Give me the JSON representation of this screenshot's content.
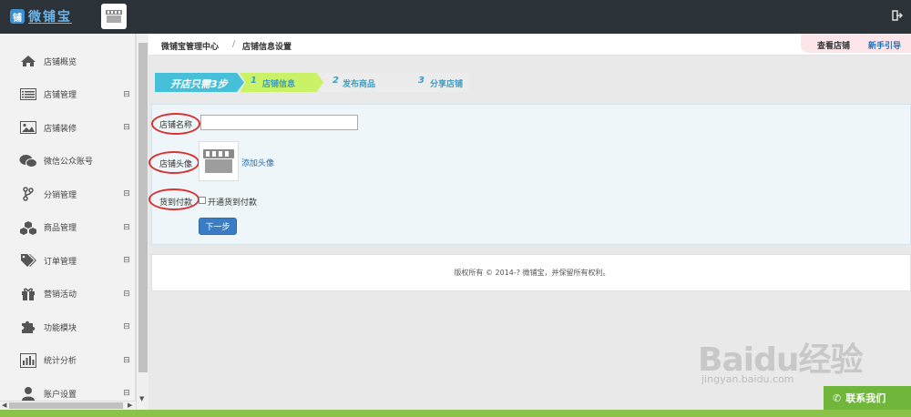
{
  "app": {
    "logo_badge": "铺",
    "logo_text": "微铺宝"
  },
  "sidebar": {
    "items": [
      {
        "label": "店铺概览",
        "icon": "home-icon",
        "expandable": false
      },
      {
        "label": "店铺管理",
        "icon": "list-icon",
        "expandable": true
      },
      {
        "label": "店铺装修",
        "icon": "image-icon",
        "expandable": true
      },
      {
        "label": "微信公众账号",
        "icon": "wechat-icon",
        "expandable": false
      },
      {
        "label": "分销管理",
        "icon": "branch-icon",
        "expandable": true
      },
      {
        "label": "商品管理",
        "icon": "cubes-icon",
        "expandable": true
      },
      {
        "label": "订单管理",
        "icon": "tags-icon",
        "expandable": true
      },
      {
        "label": "营销活动",
        "icon": "gift-icon",
        "expandable": true
      },
      {
        "label": "功能模块",
        "icon": "puzzle-icon",
        "expandable": true
      },
      {
        "label": "统计分析",
        "icon": "bar-chart-icon",
        "expandable": true
      },
      {
        "label": "账户设置",
        "icon": "user-icon",
        "expandable": true
      }
    ],
    "expand_symbol": "⊟"
  },
  "breadcrumb": {
    "root": "微铺宝管理中心",
    "separator": "/",
    "current": "店铺信息设置"
  },
  "header_actions": {
    "view_shop": "查看店铺",
    "new_guide": "新手引导"
  },
  "steps": {
    "intro": "开店只需3步",
    "items": [
      {
        "num": "1",
        "label": "店铺信息"
      },
      {
        "num": "2",
        "label": "发布商品"
      },
      {
        "num": "3",
        "label": "分享店铺"
      }
    ]
  },
  "form": {
    "shop_name_label": "店铺名称",
    "shop_name_value": "",
    "avatar_label": "店铺头像",
    "add_avatar_link": "添加头像",
    "cod_label": "货到付款",
    "cod_checkbox_label": "开通货到付款",
    "cod_checked": false,
    "next_button": "下一步"
  },
  "footer": {
    "copyright": "版权所有 © 2014-? 微铺宝，并保留所有权利。"
  },
  "watermark": {
    "brand": "Baidu经验",
    "url": "jingyan.baidu.com"
  },
  "contact": {
    "label": "联系我们"
  },
  "colors": {
    "topbar": "#2b3339",
    "step_intro": "#46c0d8",
    "step_active": "#c9f267",
    "primary_button": "#3b7dc4",
    "annotation": "#d83232",
    "contact": "#6fb63a"
  }
}
